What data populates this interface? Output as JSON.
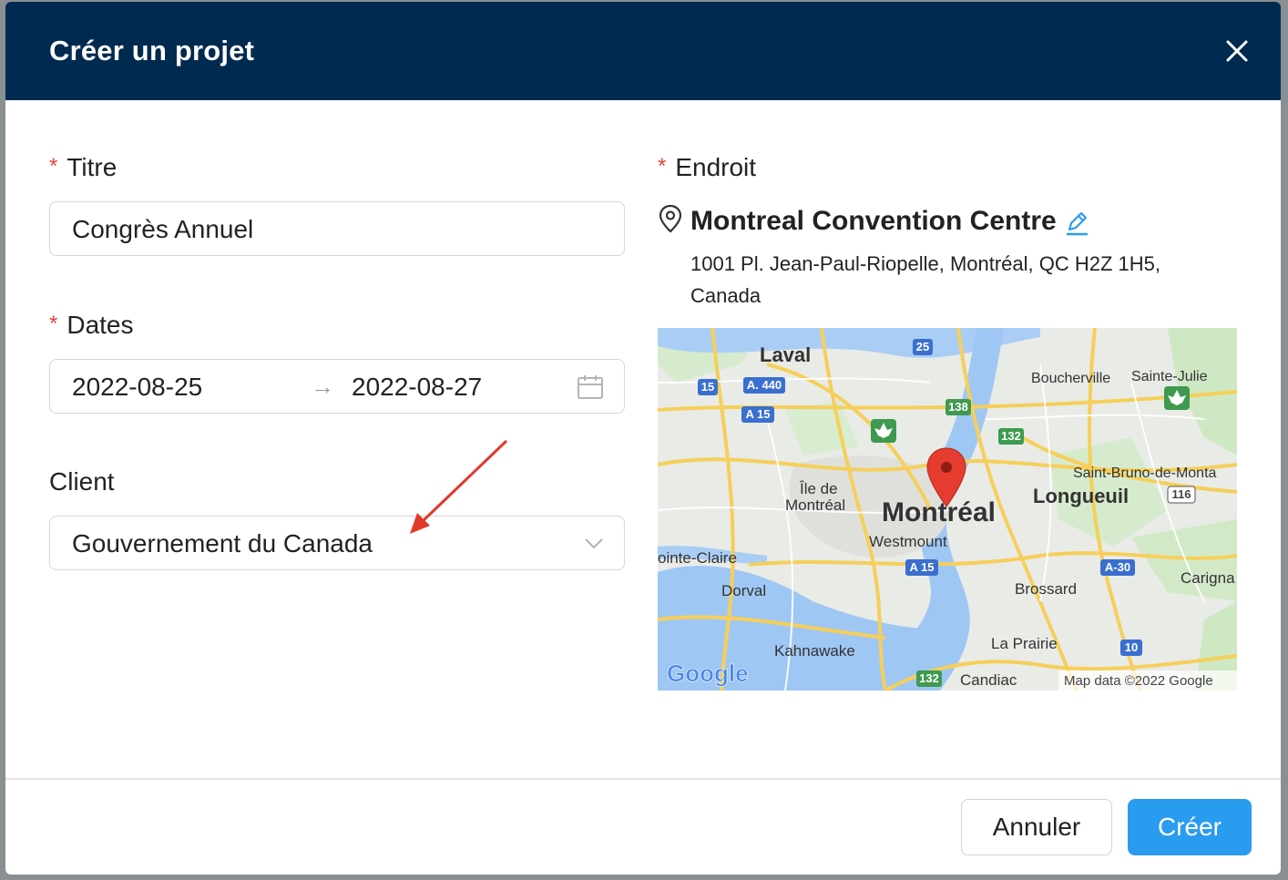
{
  "modal": {
    "title": "Créer un projet"
  },
  "form": {
    "required_mark": "*",
    "title_label": "Titre",
    "title_value": "Congrès Annuel",
    "dates_label": "Dates",
    "date_start": "2022-08-25",
    "date_separator": "→",
    "date_end": "2022-08-27",
    "client_label": "Client",
    "client_value": "Gouvernement du Canada",
    "location_label": "Endroit"
  },
  "location": {
    "name": "Montreal Convention Centre",
    "address": "1001 Pl. Jean-Paul-Riopelle, Montréal, QC H2Z 1H5, Canada"
  },
  "map": {
    "labels": {
      "laval": "Laval",
      "boucherville": "Boucherville",
      "sainte_julie": "Sainte-Julie",
      "saint_bruno": "Saint-Bruno-de-Monta",
      "longueuil": "Longueuil",
      "ile_de": "Île de",
      "montreal_island": "Montréal",
      "montreal": "Montréal",
      "westmount": "Westmount",
      "pointe_claire": "ointe-Claire",
      "dorval": "Dorval",
      "brossard": "Brossard",
      "carignan": "Carigna",
      "kahnawake": "Kahnawake",
      "la_prairie": "La Prairie",
      "candiac": "Candiac"
    },
    "shields": {
      "r25": "25",
      "r15a": "15",
      "a440": "A. 440",
      "a15a": "A 15",
      "r138": "138",
      "r132a": "132",
      "r116": "116",
      "a15b": "A 15",
      "a30": "A-30",
      "r10": "10",
      "r132b": "132"
    },
    "logo": "Google",
    "attribution": "Map data ©2022 Google"
  },
  "footer": {
    "cancel_label": "Annuler",
    "create_label": "Créer"
  },
  "colors": {
    "header_bg": "#002a4f",
    "primary": "#2a9cf0",
    "required": "#e8433c",
    "annotation_arrow": "#e03a2a"
  }
}
